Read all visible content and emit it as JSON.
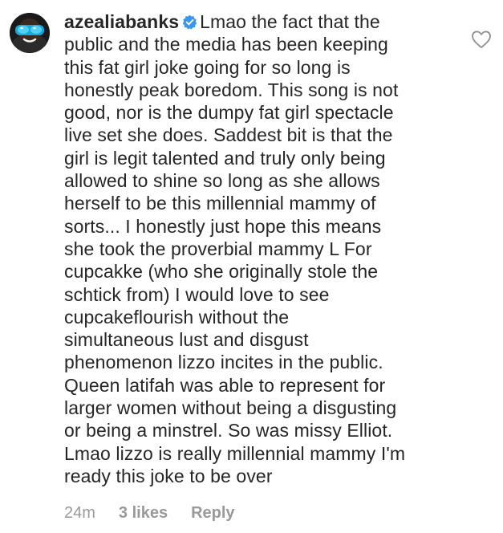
{
  "comment": {
    "avatar_icon": "profile-picture-blue-goggles",
    "username": "azealiabanks",
    "verified_icon": "verified-badge-icon",
    "verified_color": "#3897f0",
    "text": "Lmao the fact that the\npublic and the media has been keeping\nthis fat girl joke going for so long is\nhonestly peak boredom. This song is not\ngood, nor is the dumpy fat girl spectacle\nlive set she does. Saddest bit is that the\ngirl is legit talented and truly only being\nallowed to shine so long as she allows\nherself to be this millennial mammy of\nsorts... I honestly just hope this means\nshe took the proverbial mammy L For\ncupcakke (who she originally stole the\nschtick from) I would love to see\ncupcakeflourish without the\nsimultaneous lust and disgust\nphenomenon lizzo incites in the public.\nQueen latifah was able to represent for\nlarger women without being a disgusting\nor being a minstrel. So was missy Elliot.\nLmao lizzo is really millennial mammy I'm\nready this joke to be over",
    "like_icon": "heart-outline-icon",
    "meta": {
      "time": "24m",
      "likes": "3 likes",
      "reply": "Reply"
    }
  }
}
